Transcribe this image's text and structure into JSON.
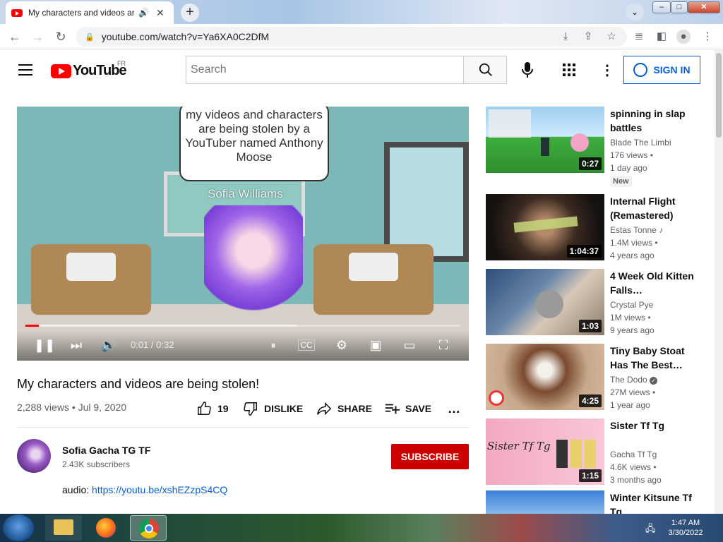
{
  "browser": {
    "tab_title": "My characters and videos are being stolen! - YouTube",
    "new_tab_label": "+",
    "tab_menu_label": "⌄",
    "url": "youtube.com/watch?v=Ya6XA0C2DfM",
    "window_buttons": {
      "minimize": "–",
      "maximize": "□",
      "close": "✕"
    }
  },
  "header": {
    "logo_text": "YouTube",
    "country": "FR",
    "search_placeholder": "Search",
    "sign_in": "SIGN IN"
  },
  "player": {
    "overlay_text": "my videos and characters are being stolen by a YouTuber named Anthony Moose",
    "watermark": "Sofia Williams",
    "time": "0:01 / 0:32",
    "progress_fraction": 0.031,
    "buffered_fraction": 0.625
  },
  "video": {
    "title": "My characters and videos are being stolen!",
    "meta": "2,288 views • Jul 9, 2020",
    "likes": "19",
    "dislike": "DISLIKE",
    "share": "SHARE",
    "save": "SAVE",
    "more": "…"
  },
  "channel": {
    "name": "Sofia Gacha TG TF",
    "subs": "2.43K subscribers",
    "subscribe": "SUBSCRIBE",
    "desc_label": "audio:",
    "desc_link": "https://youtu.be/xshEZzpS4CQ"
  },
  "recommendations": [
    {
      "title": "spinning in slap battles",
      "channel": "Blade The Limbi",
      "views": "176 views •",
      "age": "1 day ago",
      "badge": "New",
      "duration": "0:27"
    },
    {
      "title": "Internal Flight (Remastered)",
      "channel": "Estas Tonne",
      "views": "1.4M views •",
      "age": "4 years ago",
      "duration": "1:04:37"
    },
    {
      "title": "4 Week Old Kitten Falls…",
      "channel": "Crystal Pye",
      "views": "1M views •",
      "age": "9 years ago",
      "duration": "1:03"
    },
    {
      "title": "Tiny Baby Stoat Has The Best…",
      "channel": "The Dodo",
      "views": "27M views •",
      "age": "1 year ago",
      "duration": "4:25"
    },
    {
      "title": "Sister Tf Tg",
      "channel": "Gacha Tf Tg",
      "views": "4.6K views •",
      "age": "3 months ago",
      "duration": "1:15",
      "thumb_text": "Sister Tf Tg"
    },
    {
      "title": "Winter Kitsune Tf Tg",
      "channel": "",
      "views": "",
      "age": "",
      "duration": ""
    }
  ],
  "taskbar": {
    "time": "1:47 AM",
    "date": "3/30/2022"
  },
  "colors": {
    "youtube_red": "#ff0000",
    "subscribe_red": "#cc0000",
    "link_blue": "#065fd4"
  }
}
